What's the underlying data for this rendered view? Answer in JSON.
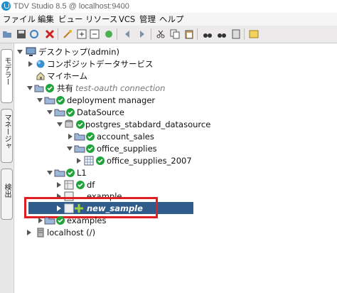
{
  "window": {
    "title": "TDV Studio 8.5 @ localhost:9400"
  },
  "menu": {
    "items": [
      {
        "label": "ファイル"
      },
      {
        "label": "編集"
      },
      {
        "label": "ビュー"
      },
      {
        "label": "リソース"
      },
      {
        "label": "VCS"
      },
      {
        "label": "管理"
      },
      {
        "label": "ヘルプ"
      }
    ]
  },
  "sidetabs": {
    "modeler": "モデラー",
    "manager": "マネージャ",
    "search": "検出"
  },
  "tree": {
    "desktop": "デスクトップ(admin)",
    "composite_data_services": "コンポジットデータサービス",
    "my_home": "マイホーム",
    "shared": "共有",
    "shared_note": "test-oauth connection",
    "deployment_manager": "deployment manager",
    "datasource": "DataSource",
    "postgres": "postgres_stabdard_datasource",
    "account_sales": "account_sales",
    "office_supplies": "office_supplies",
    "office_supplies_2007": "office_supplies_2007",
    "l1": "L1",
    "df": "df",
    "example": "example",
    "new_sample": "new_sample",
    "examples": "examples",
    "localhost": "localhost (/)"
  },
  "colors": {
    "selection": "#2f5c8a",
    "highlight_box": "#e02020",
    "check": "#1fa33a",
    "folder": "#9db8d6"
  }
}
